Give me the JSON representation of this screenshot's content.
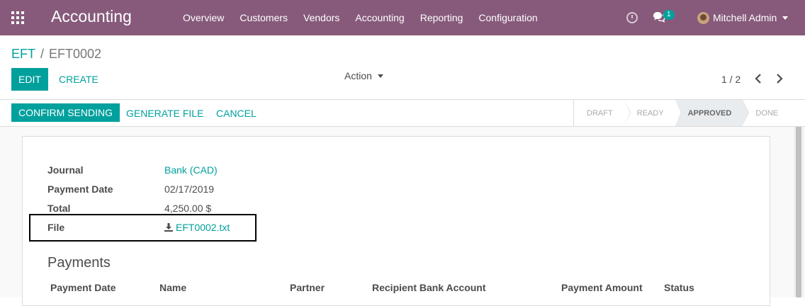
{
  "navbar": {
    "brand": "Accounting",
    "menu": [
      "Overview",
      "Customers",
      "Vendors",
      "Accounting",
      "Reporting",
      "Configuration"
    ],
    "chat_count": "1",
    "user_name": "Mitchell Admin",
    "icons": [
      "apps-icon",
      "clock-icon",
      "chat-icon",
      "avatar",
      "chevron-down-icon"
    ]
  },
  "breadcrumb": {
    "parent": "EFT",
    "separator": "/",
    "current": "EFT0002"
  },
  "control_panel": {
    "edit_label": "EDIT",
    "create_label": "CREATE",
    "action_label": "Action",
    "pager": "1 / 2"
  },
  "statusbar": {
    "confirm_label": "CONFIRM SENDING",
    "generate_label": "GENERATE FILE",
    "cancel_label": "CANCEL",
    "stages": [
      "DRAFT",
      "READY",
      "APPROVED",
      "DONE"
    ],
    "active_stage": "APPROVED"
  },
  "form": {
    "journal_label": "Journal",
    "journal_value": "Bank (CAD)",
    "payment_date_label": "Payment Date",
    "payment_date_value": "02/17/2019",
    "total_label": "Total",
    "total_value": "4,250.00 $",
    "file_label": "File",
    "file_value": "EFT0002.txt"
  },
  "payments": {
    "title": "Payments",
    "columns": [
      "Payment Date",
      "Name",
      "Partner",
      "Recipient Bank Account",
      "Payment Amount",
      "Status"
    ]
  },
  "colors": {
    "navbar": "#875a7b",
    "accent": "#00a09d"
  }
}
